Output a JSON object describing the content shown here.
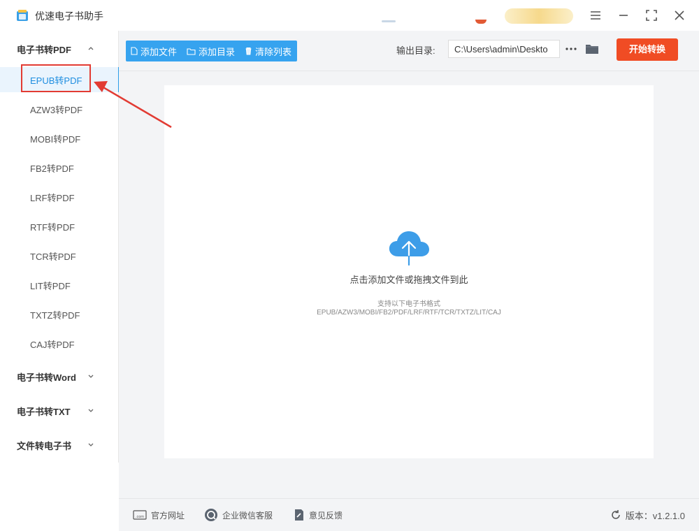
{
  "app": {
    "title": "优速电子书助手"
  },
  "sidebar": {
    "groups": [
      {
        "label": "电子书转PDF",
        "expanded": true
      },
      {
        "label": "电子书转Word",
        "expanded": false
      },
      {
        "label": "电子书转TXT",
        "expanded": false
      },
      {
        "label": "文件转电子书",
        "expanded": false
      }
    ],
    "items": [
      {
        "label": "EPUB转PDF",
        "active": true
      },
      {
        "label": "AZW3转PDF"
      },
      {
        "label": "MOBI转PDF"
      },
      {
        "label": "FB2转PDF"
      },
      {
        "label": "LRF转PDF"
      },
      {
        "label": "RTF转PDF"
      },
      {
        "label": "TCR转PDF"
      },
      {
        "label": "LIT转PDF"
      },
      {
        "label": "TXTZ转PDF"
      },
      {
        "label": "CAJ转PDF"
      }
    ]
  },
  "toolbar": {
    "add_file": "添加文件",
    "add_dir": "添加目录",
    "clear_list": "清除列表",
    "output_label": "输出目录:",
    "output_path": "C:\\Users\\admin\\Deskto",
    "start": "开始转换"
  },
  "dropzone": {
    "title": "点击添加文件或拖拽文件到此",
    "subtitle": "支持以下电子书格式",
    "formats": "EPUB/AZW3/MOBI/FB2/PDF/LRF/RTF/TCR/TXTZ/LIT/CAJ"
  },
  "footer": {
    "website": "官方网址",
    "wechat": "企业微信客服",
    "feedback": "意见反馈",
    "version": "版本：v1.2.1.0"
  },
  "colors": {
    "accent": "#36a3ef",
    "start_button": "#f04c24",
    "highlight": "#e23b33",
    "active_text": "#1e8ee0"
  }
}
